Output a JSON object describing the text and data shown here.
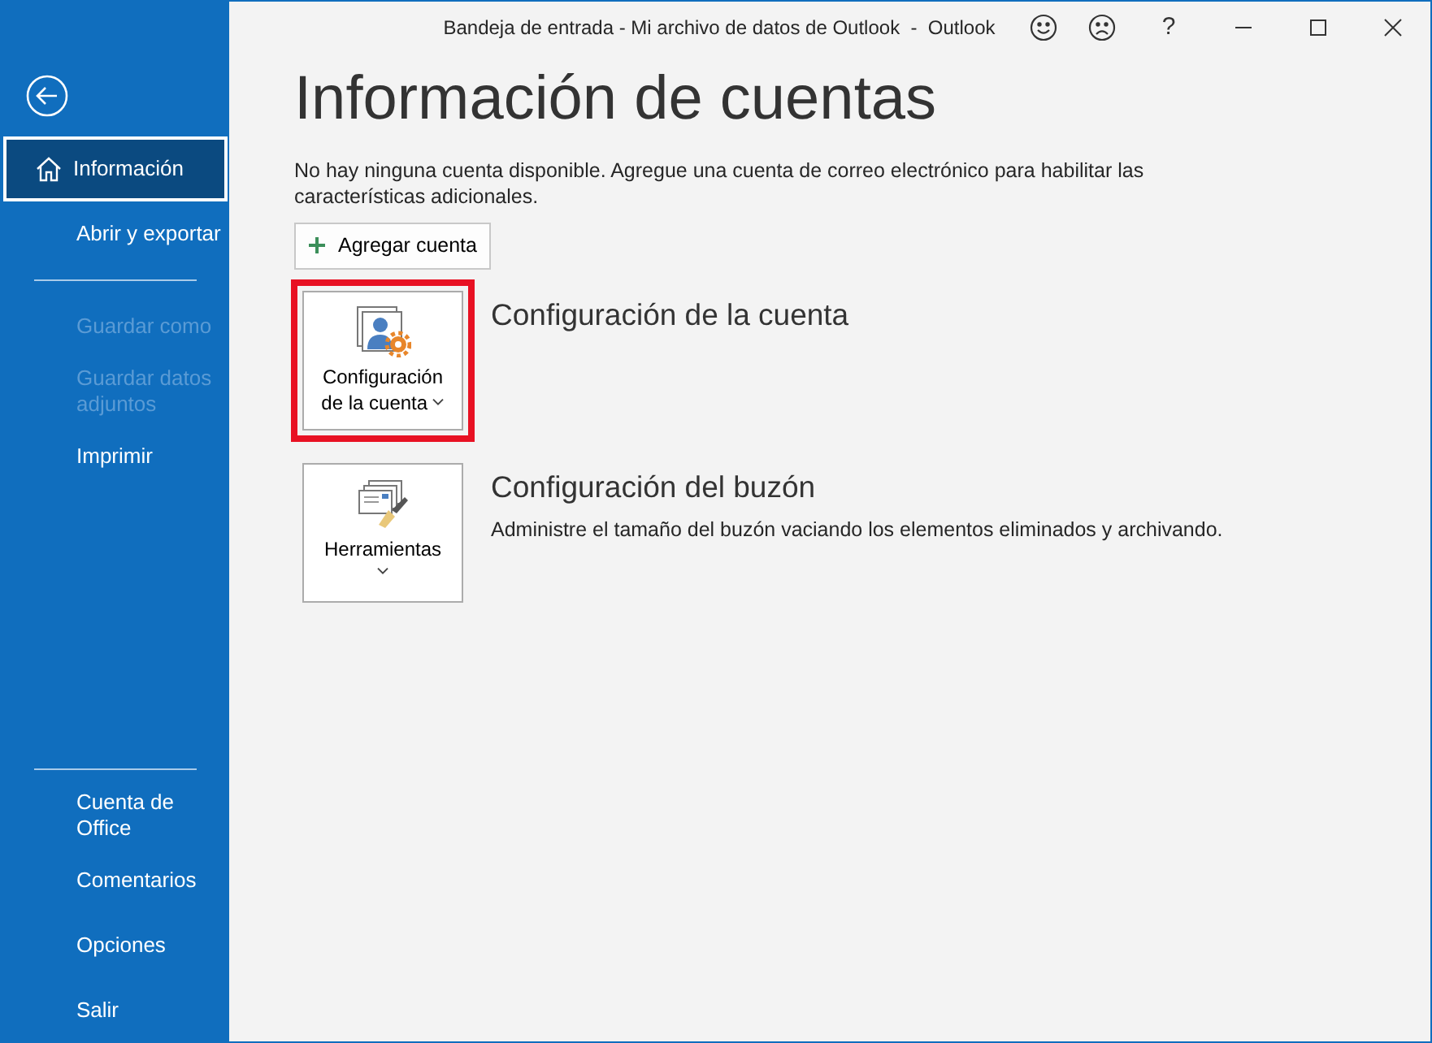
{
  "window": {
    "title": "Bandeja de entrada - Mi archivo de datos de Outlook  -  Outlook",
    "help": "?"
  },
  "sidebar": {
    "items": [
      {
        "kind": "item",
        "label": "Información",
        "selected": true,
        "disabled": false
      },
      {
        "kind": "item",
        "label": "Abrir y exportar",
        "selected": false,
        "disabled": false
      },
      {
        "kind": "separator"
      },
      {
        "kind": "item",
        "label": "Guardar como",
        "selected": false,
        "disabled": true
      },
      {
        "kind": "item",
        "label": "Guardar datos adjuntos",
        "selected": false,
        "disabled": true
      },
      {
        "kind": "item",
        "label": "Imprimir",
        "selected": false,
        "disabled": false
      },
      {
        "kind": "spacer"
      },
      {
        "kind": "separator"
      },
      {
        "kind": "item",
        "label": "Cuenta de Office",
        "selected": false,
        "disabled": false
      },
      {
        "kind": "item",
        "label": "Comentarios",
        "selected": false,
        "disabled": false
      },
      {
        "kind": "item",
        "label": "Opciones",
        "selected": false,
        "disabled": false
      },
      {
        "kind": "item",
        "label": "Salir",
        "selected": false,
        "disabled": false
      }
    ]
  },
  "main": {
    "heading": "Información de cuentas",
    "message": "No hay ninguna cuenta disponible. Agregue una cuenta de correo electrónico para habilitar las características adicionales.",
    "add_account_button": "Agregar cuenta",
    "sections": [
      {
        "button_label": "Configuración de la cuenta",
        "title": "Configuración de la cuenta",
        "highlighted": true
      },
      {
        "button_label": "Herramientas",
        "title": "Configuración del buzón",
        "description": "Administre el tamaño del buzón vaciando los elementos eliminados y archivando.",
        "highlighted": false
      }
    ]
  }
}
